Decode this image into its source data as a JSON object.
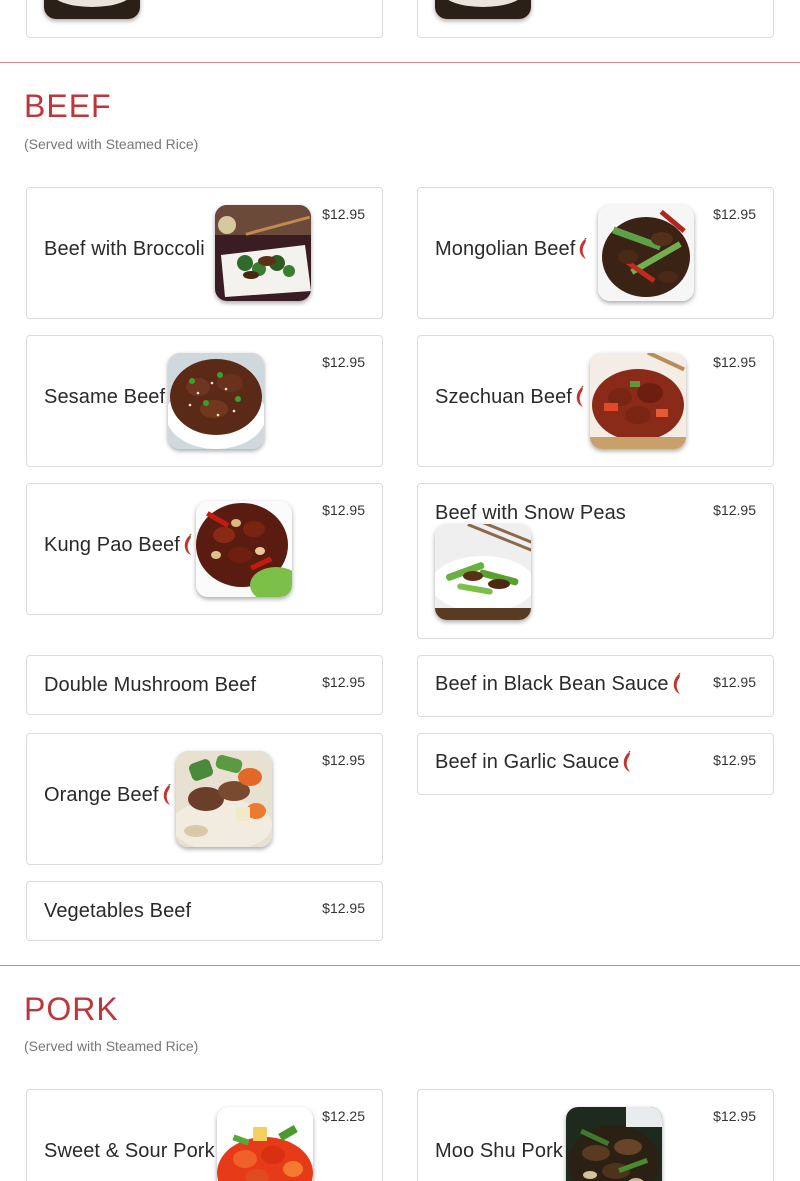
{
  "prev_section": {
    "items": [
      {
        "name": ""
      },
      {
        "name": ""
      }
    ]
  },
  "beef": {
    "title": "BEEF",
    "subtitle": "(Served with Steamed Rice)",
    "items": [
      {
        "name": "Beef with Broccoli",
        "price": "$12.95",
        "spicy": false,
        "image": "beef-broccoli"
      },
      {
        "name": "Mongolian Beef",
        "price": "$12.95",
        "spicy": true,
        "image": "mongolian-beef"
      },
      {
        "name": "Sesame Beef",
        "price": "$12.95",
        "spicy": false,
        "image": "sesame-beef"
      },
      {
        "name": "Szechuan Beef",
        "price": "$12.95",
        "spicy": true,
        "image": "szechuan-beef"
      },
      {
        "name": "Kung Pao Beef",
        "price": "$12.95",
        "spicy": true,
        "image": "kung-pao-beef"
      },
      {
        "name": "Beef with Snow Peas",
        "price": "$12.95",
        "spicy": false,
        "image": "beef-snow-peas"
      },
      {
        "name": "Double Mushroom Beef",
        "price": "$12.95",
        "spicy": false,
        "image": ""
      },
      {
        "name": "Beef in Black Bean Sauce",
        "price": "$12.95",
        "spicy": true,
        "image": ""
      },
      {
        "name": "Orange Beef",
        "price": "$12.95",
        "spicy": true,
        "image": "orange-beef"
      },
      {
        "name": "Beef in Garlic Sauce",
        "price": "$12.95",
        "spicy": true,
        "image": ""
      },
      {
        "name": "Vegetables Beef",
        "price": "$12.95",
        "spicy": false,
        "image": ""
      }
    ]
  },
  "pork": {
    "title": "PORK",
    "subtitle": "(Served with Steamed Rice)",
    "items": [
      {
        "name": "Sweet & Sour Pork",
        "price": "$12.25",
        "spicy": false,
        "image": "sweet-sour-pork"
      },
      {
        "name": "Moo Shu Pork",
        "price": "$12.95",
        "spicy": false,
        "image": "moo-shu-pork"
      }
    ]
  },
  "colors": {
    "section_title": "#c0353a",
    "divider": "#c9898b",
    "card_border": "#dcdcdc",
    "chili": "#c8322a"
  },
  "icons": {
    "spicy": "chili-pepper-icon"
  }
}
